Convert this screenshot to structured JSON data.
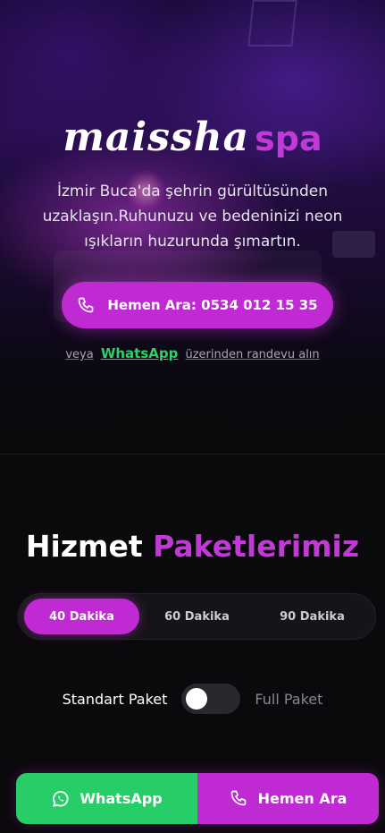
{
  "hero": {
    "brand_main": "maissha",
    "brand_accent": "spa",
    "tagline": "İzmir Buca'da şehrin gürültüsünden uzaklaşın.Ruhunuzu ve bedeninizi neon ışıkların huzurunda şımartın.",
    "call_button_label": "Hemen Ara: 0534 012 15 35",
    "alt_prefix": "veya",
    "alt_whatsapp": "WhatsApp",
    "alt_suffix": "üzerinden randevu alın"
  },
  "packages": {
    "title_plain": "Hizmet",
    "title_accent": "Paketlerimiz",
    "durations": [
      "40 Dakika",
      "60 Dakika",
      "90 Dakika"
    ],
    "selected_duration": "40 Dakika",
    "toggle_left_label": "Standart Paket",
    "toggle_right_label": "Full Paket",
    "toggle_on": false
  },
  "bottom_bar": {
    "whatsapp_label": "WhatsApp",
    "call_label": "Hemen Ara"
  },
  "colors": {
    "accent": "#c02ad3",
    "whatsapp": "#27ce68",
    "background": "#0a090b"
  },
  "icons": {
    "call_button": "phone-icon",
    "bottom_whatsapp": "whatsapp-icon",
    "bottom_call": "phone-icon"
  }
}
